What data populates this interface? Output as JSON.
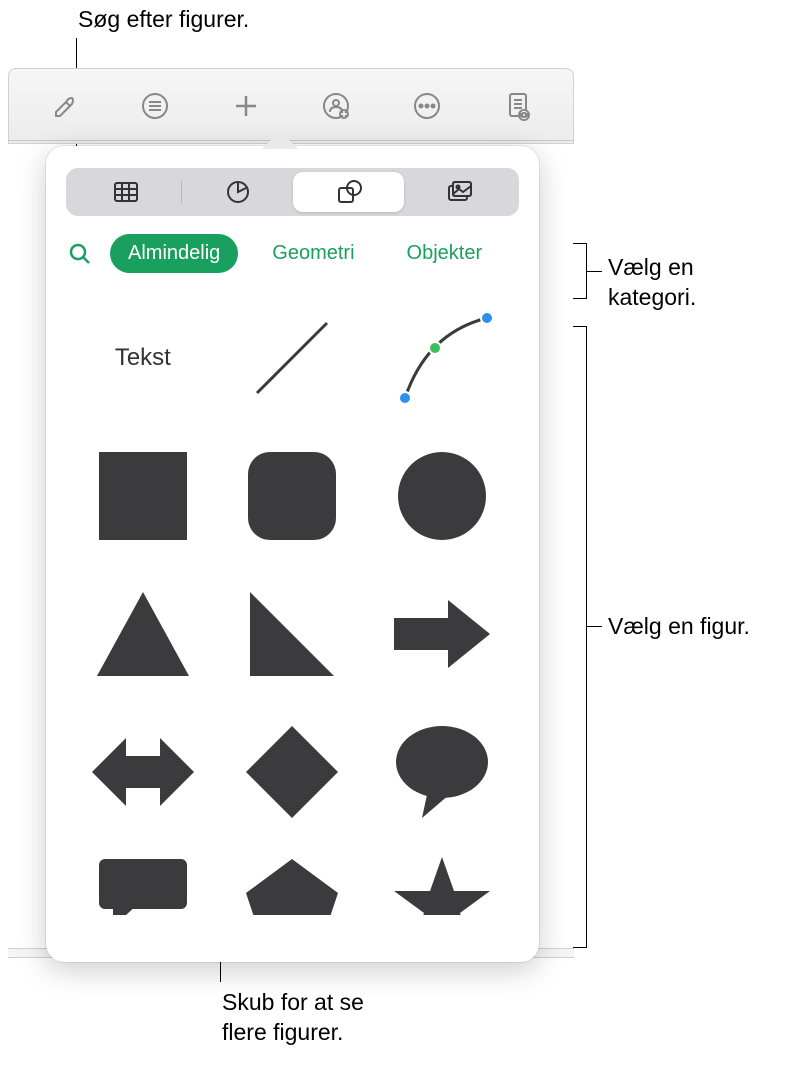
{
  "callouts": {
    "search": "Søg efter figurer.",
    "category": "Vælg en\nkategori.",
    "shape": "Vælg en figur.",
    "scroll": "Skub for at se\nflere figurer."
  },
  "toolbar": {
    "icons": [
      "format-paintbrush",
      "list",
      "plus-insert",
      "share-people",
      "more-ellipsis",
      "document-view"
    ]
  },
  "popover": {
    "segments": [
      "tables",
      "charts",
      "shapes",
      "media"
    ],
    "selectedSegment": "shapes",
    "categories": {
      "selected": "Almindelig",
      "items": [
        "Almindelig",
        "Geometri",
        "Objekter"
      ]
    },
    "shapes": {
      "row1": {
        "text": "Tekst",
        "line": "line-shape",
        "curve": "curve-shape"
      },
      "row2": [
        "square",
        "rounded-square",
        "circle"
      ],
      "row3": [
        "triangle",
        "right-triangle",
        "arrow-right"
      ],
      "row4": [
        "double-arrow",
        "diamond",
        "speech-bubble"
      ],
      "row5": [
        "callout-rect",
        "pentagon",
        "star"
      ]
    }
  }
}
